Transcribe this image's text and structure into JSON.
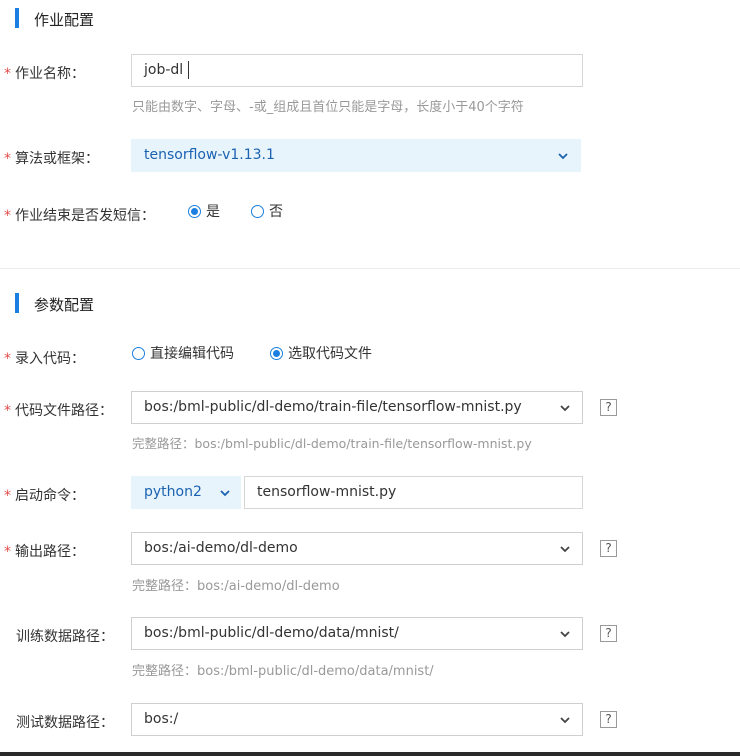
{
  "job_section": {
    "title": "作业配置",
    "name_label": "作业名称：",
    "name_value": "job-dl",
    "name_hint": "只能由数字、字母、-或_组成且首位只能是字母，长度小于40个字符",
    "framework_label": "算法或框架：",
    "framework_value": "tensorflow-v1.13.1",
    "sms_label": "作业结束是否发短信：",
    "sms_options": [
      "是",
      "否"
    ],
    "sms_selected": "是"
  },
  "param_section": {
    "title": "参数配置",
    "code_label": "录入代码：",
    "code_options": [
      "直接编辑代码",
      "选取代码文件"
    ],
    "code_selected": "选取代码文件",
    "code_path_label": "代码文件路径：",
    "code_path_value": "bos:/bml-public/dl-demo/train-file/tensorflow-mnist.py",
    "code_path_hint": "完整路径：bos:/bml-public/dl-demo/train-file/tensorflow-mnist.py",
    "start_cmd_label": "启动命令：",
    "start_cmd_interpreter": "python2",
    "start_cmd_value": "tensorflow-mnist.py",
    "output_label": "输出路径：",
    "output_value": "bos:/ai-demo/dl-demo",
    "output_hint": "完整路径：bos:/ai-demo/dl-demo",
    "train_label": "训练数据路径：",
    "train_value": "bos:/bml-public/dl-demo/data/mnist/",
    "train_hint": "完整路径：bos:/bml-public/dl-demo/data/mnist/",
    "test_label": "测试数据路径：",
    "test_value": "bos:/",
    "help_symbol": "?"
  },
  "colors": {
    "accent": "#1a7fe0",
    "required_star": "#e34b4b",
    "select_highlight_bg": "#e8f4fc"
  }
}
